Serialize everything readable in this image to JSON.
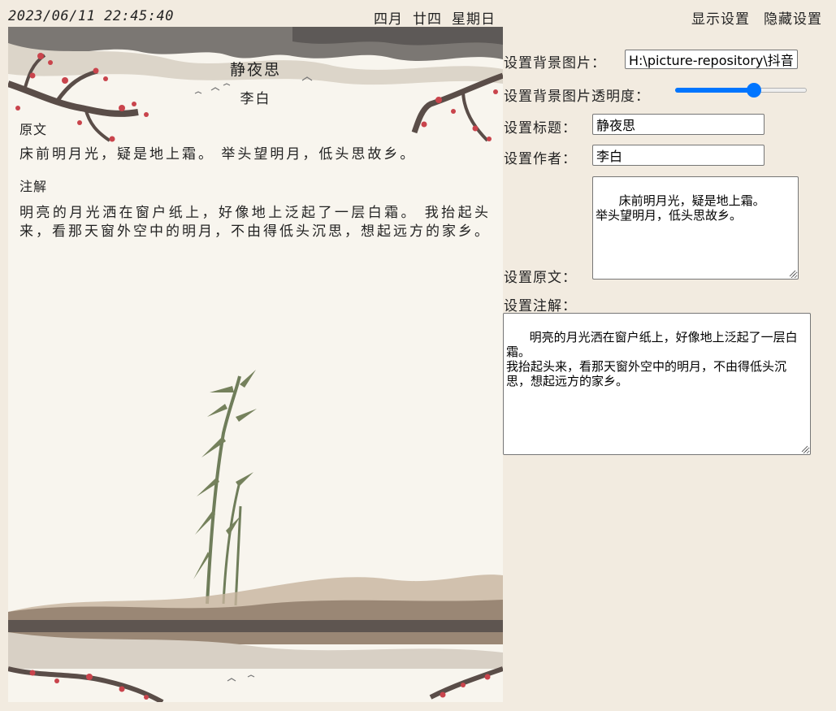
{
  "header": {
    "datetime": "2023/06/11  22:45:40",
    "lunar_month": "四月",
    "lunar_day": "廿四",
    "weekday": "星期日",
    "show_settings": "显示设置",
    "hide_settings": "隐藏设置"
  },
  "poem": {
    "title": "静夜思",
    "author": "李白",
    "original_label": "原文",
    "original": "床前明月光，疑是地上霜。 举头望明月，低头思故乡。",
    "annotation_label": "注解",
    "annotation": "明亮的月光洒在窗户纸上，好像地上泛起了一层白霜。 我抬起头来，看那天窗外空中的明月，不由得低头沉思，想起远方的家乡。"
  },
  "settings": {
    "bg_image_label": "设置背景图片：",
    "bg_image_value": "H:\\picture-repository\\抖音图",
    "opacity_label": "设置背景图片透明度：",
    "opacity_value": 0.6,
    "title_label": "设置标题：",
    "title_value": "静夜思",
    "author_label": "设置作者：",
    "author_value": "李白",
    "original_label": "设置原文：",
    "original_value": "  床前明月光，疑是地上霜。\n举头望明月，低头思故乡。",
    "annotation_label": "设置注解：",
    "annotation_value": "  明亮的月光洒在窗户纸上，好像地上泛起了一层白霜。\n我抬起头来，看那天窗外空中的明月，不由得低头沉思，想起远方的家乡。"
  },
  "colors": {
    "page_bg": "#f2ebe0",
    "card_bg": "#f8f5ee",
    "slider_accent": "#0075ff"
  }
}
